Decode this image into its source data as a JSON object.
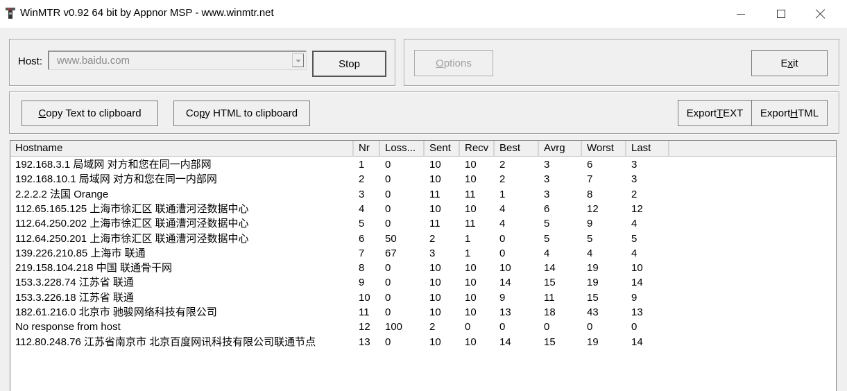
{
  "window": {
    "title": "WinMTR v0.92 64 bit by Appnor MSP - www.winmtr.net",
    "app_icon": "winmtr-app-icon",
    "controls": {
      "minimize_icon": "minimize-icon",
      "maximize_icon": "maximize-icon",
      "close_icon": "close-icon"
    }
  },
  "host": {
    "label": "Host:",
    "value": "www.baidu.com",
    "dropdown_icon": "chevron-down-icon"
  },
  "buttons": {
    "stop": "Stop",
    "options": {
      "pre": "",
      "accel": "O",
      "post": "ptions",
      "disabled": true
    },
    "exit": {
      "pre": "E",
      "accel": "x",
      "post": "it"
    },
    "copy_text": {
      "pre": "",
      "accel": "C",
      "post": "opy Text to clipboard"
    },
    "copy_html": {
      "pre": "Co",
      "accel": "p",
      "post": "y HTML to clipboard"
    },
    "export_text": {
      "pre": "Export ",
      "accel": "T",
      "post": "EXT"
    },
    "export_html": {
      "pre": "Export ",
      "accel": "H",
      "post": "TML"
    }
  },
  "table": {
    "columns": [
      "Hostname",
      "Nr",
      "Loss...",
      "Sent",
      "Recv",
      "Best",
      "Avrg",
      "Worst",
      "Last"
    ],
    "rows": [
      {
        "hostname": "192.168.3.1 局域网 对方和您在同一内部网",
        "nr": "1",
        "loss": "0",
        "sent": "10",
        "recv": "10",
        "best": "2",
        "avrg": "3",
        "worst": "6",
        "last": "3"
      },
      {
        "hostname": "192.168.10.1 局域网 对方和您在同一内部网",
        "nr": "2",
        "loss": "0",
        "sent": "10",
        "recv": "10",
        "best": "2",
        "avrg": "3",
        "worst": "7",
        "last": "3"
      },
      {
        "hostname": "2.2.2.2 法国 Orange",
        "nr": "3",
        "loss": "0",
        "sent": "11",
        "recv": "11",
        "best": "1",
        "avrg": "3",
        "worst": "8",
        "last": "2"
      },
      {
        "hostname": "112.65.165.125 上海市徐汇区 联通漕河泾数据中心",
        "nr": "4",
        "loss": "0",
        "sent": "10",
        "recv": "10",
        "best": "4",
        "avrg": "6",
        "worst": "12",
        "last": "12"
      },
      {
        "hostname": "112.64.250.202 上海市徐汇区 联通漕河泾数据中心",
        "nr": "5",
        "loss": "0",
        "sent": "11",
        "recv": "11",
        "best": "4",
        "avrg": "5",
        "worst": "9",
        "last": "4"
      },
      {
        "hostname": "112.64.250.201 上海市徐汇区 联通漕河泾数据中心",
        "nr": "6",
        "loss": "50",
        "sent": "2",
        "recv": "1",
        "best": "0",
        "avrg": "5",
        "worst": "5",
        "last": "5"
      },
      {
        "hostname": "139.226.210.85 上海市 联通",
        "nr": "7",
        "loss": "67",
        "sent": "3",
        "recv": "1",
        "best": "0",
        "avrg": "4",
        "worst": "4",
        "last": "4"
      },
      {
        "hostname": "219.158.104.218 中国 联通骨干网",
        "nr": "8",
        "loss": "0",
        "sent": "10",
        "recv": "10",
        "best": "10",
        "avrg": "14",
        "worst": "19",
        "last": "10"
      },
      {
        "hostname": "153.3.228.74 江苏省 联通",
        "nr": "9",
        "loss": "0",
        "sent": "10",
        "recv": "10",
        "best": "14",
        "avrg": "15",
        "worst": "19",
        "last": "14"
      },
      {
        "hostname": "153.3.226.18 江苏省 联通",
        "nr": "10",
        "loss": "0",
        "sent": "10",
        "recv": "10",
        "best": "9",
        "avrg": "11",
        "worst": "15",
        "last": "9"
      },
      {
        "hostname": "182.61.216.0 北京市 驰骏网络科技有限公司",
        "nr": "11",
        "loss": "0",
        "sent": "10",
        "recv": "10",
        "best": "13",
        "avrg": "18",
        "worst": "43",
        "last": "13"
      },
      {
        "hostname": "No response from host",
        "nr": "12",
        "loss": "100",
        "sent": "2",
        "recv": "0",
        "best": "0",
        "avrg": "0",
        "worst": "0",
        "last": "0"
      },
      {
        "hostname": "112.80.248.76 江苏省南京市 北京百度网讯科技有限公司联通节点",
        "nr": "13",
        "loss": "0",
        "sent": "10",
        "recv": "10",
        "best": "14",
        "avrg": "15",
        "worst": "19",
        "last": "14"
      }
    ]
  }
}
